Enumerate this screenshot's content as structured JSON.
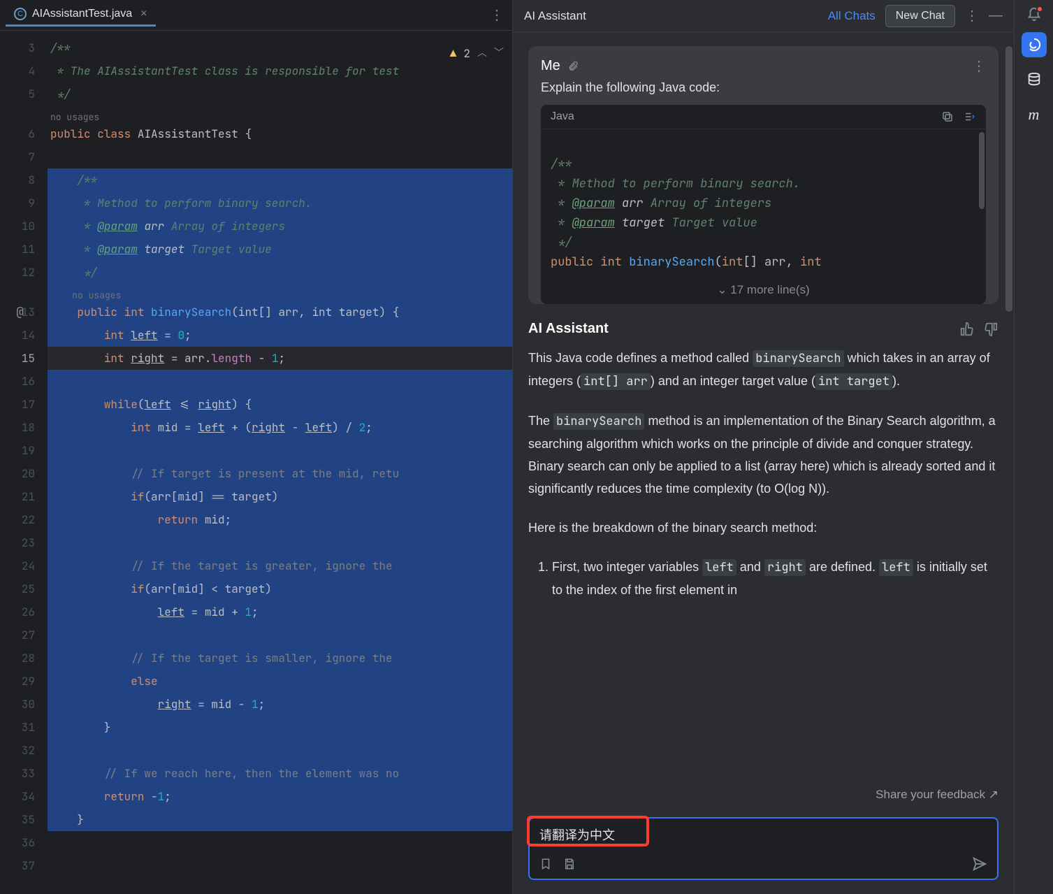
{
  "editor": {
    "tab_name": "AIAssistantTest.java",
    "warning_count": "2",
    "usages_hint": "no usages",
    "lines": {
      "l3": "/**",
      "l4": " * The AIAssistantTest class is responsible for test",
      "l5": " */",
      "l6_public": "public",
      "l6_class": "class",
      "l6_name": "AIAssistantTest",
      "l6_brace": " {",
      "l8": "/**",
      "l9": " * Method to perform binary search.",
      "l10a": " * ",
      "l10tag": "@param",
      "l10b": " ",
      "l10arr": "arr",
      "l10c": " Array of integers",
      "l11a": " * ",
      "l11tag": "@param",
      "l11b": " ",
      "l11tgt": "target",
      "l11c": " Target value",
      "l12": " */",
      "l13_public": "public",
      "l13_int": "int",
      "l13_method": "binarySearch",
      "l13_rest": "(int[] arr, int target) {",
      "l14_int": "int",
      "l14_left": "left",
      "l14_eq": " = ",
      "l14_zero": "0",
      "l14_semi": ";",
      "l15_int": "int",
      "l15_right": "right",
      "l15_eq": " = arr.",
      "l15_len": "length",
      "l15_min": " - ",
      "l15_one": "1",
      "l15_semi": ";",
      "l17_while": "while",
      "l17_rest1": "(",
      "l17_left": "left",
      "l17_op": " <= ",
      "l17_right": "right",
      "l17_rest2": ") {",
      "l18_int": "int",
      "l18_rest": " mid = ",
      "l18_left": "left",
      "l18_plus": " + (",
      "l18_right": "right",
      "l18_min": " - ",
      "l18_left2": "left",
      "l18_div": ") / ",
      "l18_two": "2",
      "l18_semi": ";",
      "l20": "// If target is present at the mid, retu",
      "l21_if": "if",
      "l21_rest": "(arr[mid] == target)",
      "l22_ret": "return",
      "l22_rest": " mid;",
      "l24": "// If the target is greater, ignore the ",
      "l25_if": "if",
      "l25_rest": "(arr[mid] < target)",
      "l26_left": "left",
      "l26_rest": " = mid + ",
      "l26_one": "1",
      "l26_semi": ";",
      "l28": "// If the target is smaller, ignore the ",
      "l29_else": "else",
      "l30_right": "right",
      "l30_rest": " = mid - ",
      "l30_one": "1",
      "l30_semi": ";",
      "l31": "}",
      "l33": "// If we reach here, then the element was no",
      "l34_ret": "return",
      "l34_rest": " -",
      "l34_one": "1",
      "l34_semi": ";",
      "l35": "}"
    },
    "gutter": [
      "3",
      "4",
      "5",
      "6",
      "7",
      "8",
      "9",
      "10",
      "11",
      "12",
      "13",
      "14",
      "15",
      "16",
      "17",
      "18",
      "19",
      "20",
      "21",
      "22",
      "23",
      "24",
      "25",
      "26",
      "27",
      "28",
      "29",
      "30",
      "31",
      "32",
      "33",
      "34",
      "35",
      "36",
      "37"
    ],
    "current_line": "15"
  },
  "assistant": {
    "header_title": "AI Assistant",
    "all_chats": "All Chats",
    "new_chat": "New Chat",
    "user_name": "Me",
    "user_text": "Explain the following Java code:",
    "code_lang": "Java",
    "code_lines": {
      "c1": "/**",
      "c2": " * Method to perform binary search.",
      "c3a": " * ",
      "c3tag": "@param",
      "c3b": " ",
      "c3arr": "arr",
      "c3c": " Array of integers",
      "c4a": " * ",
      "c4tag": "@param",
      "c4b": " ",
      "c4tgt": "target",
      "c4c": " Target value",
      "c5": " */",
      "c6_public": "public",
      "c6_int": "int",
      "c6_method": "binarySearch",
      "c6_rest": "(",
      "c6_int2": "int",
      "c6_rest2": "[] arr, ",
      "c6_int3": "int"
    },
    "more_lines": "17 more line(s)",
    "ai_title": "AI Assistant",
    "ai_p1_a": "This Java code defines a method called ",
    "ai_p1_c1": "binarySearch",
    "ai_p1_b": " which takes in an array of integers (",
    "ai_p1_c2": "int[] arr",
    "ai_p1_c": ") and an integer target value (",
    "ai_p1_c3": "int target",
    "ai_p1_d": ").",
    "ai_p2_a": "The ",
    "ai_p2_c1": "binarySearch",
    "ai_p2_b": " method is an implementation of the Binary Search algorithm, a searching algorithm which works on the principle of divide and conquer strategy. Binary search can only be applied to a list (array here) which is already sorted and it significantly reduces the time complexity (to O(log N)).",
    "ai_p3": "Here is the breakdown of the binary search method:",
    "ai_li1_a": "First, two integer variables ",
    "ai_li1_c1": "left",
    "ai_li1_b": " and ",
    "ai_li1_c2": "right",
    "ai_li1_c": " are defined. ",
    "ai_li1_c3": "left",
    "ai_li1_d": " is initially set to the index of the first element in",
    "feedback": "Share your feedback ↗",
    "input_text": "请翻译为中文"
  },
  "rail": {
    "ai_icon": "ai-swirl-icon",
    "db_icon": "database-icon",
    "m_icon": "m-icon"
  }
}
